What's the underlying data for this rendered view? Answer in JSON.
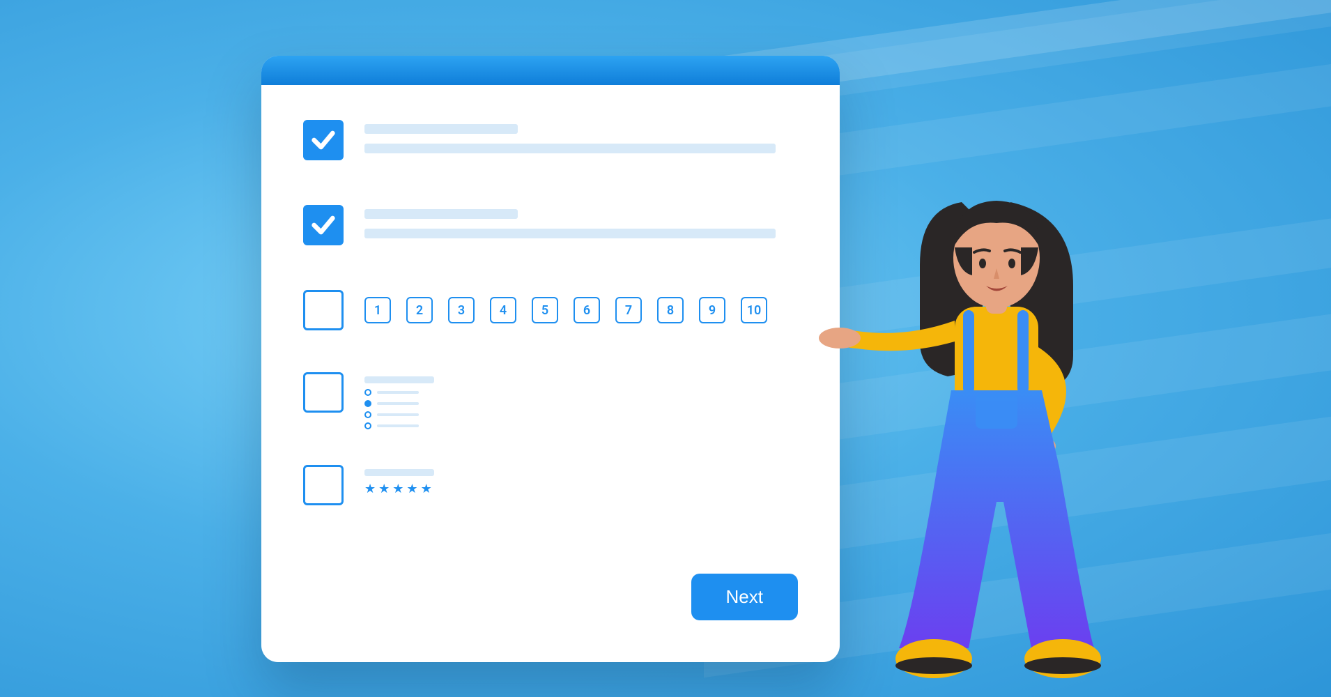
{
  "colors": {
    "accent": "#1e8ff0",
    "placeholder": "#d7e9f8",
    "bg_gradient_start": "#7dd3f8",
    "bg_gradient_end": "#2d95d8"
  },
  "card": {
    "questions": [
      {
        "type": "checkbox",
        "checked": true,
        "has_short_line": true,
        "has_long_line": true
      },
      {
        "type": "checkbox",
        "checked": true,
        "has_short_line": true,
        "has_long_line": true
      },
      {
        "type": "scale",
        "checked": false,
        "scale": [
          "1",
          "2",
          "3",
          "4",
          "5",
          "6",
          "7",
          "8",
          "9",
          "10"
        ]
      },
      {
        "type": "radio",
        "checked": false,
        "options_count": 4,
        "selected_index": 1
      },
      {
        "type": "rating",
        "checked": false,
        "stars": 5
      }
    ],
    "next_button": "Next"
  },
  "character": {
    "description": "3D cartoon woman with dark hair, yellow long-sleeve shirt, blue-purple overalls, yellow sneakers, left hand raised palm-up presenting the card",
    "hair_color": "#2a2626",
    "skin_color": "#e7a583",
    "shirt_color": "#f5b60a",
    "overalls_top": "#3a8df5",
    "overalls_bottom": "#6b3ff0",
    "shoes_color": "#f5b60a"
  }
}
